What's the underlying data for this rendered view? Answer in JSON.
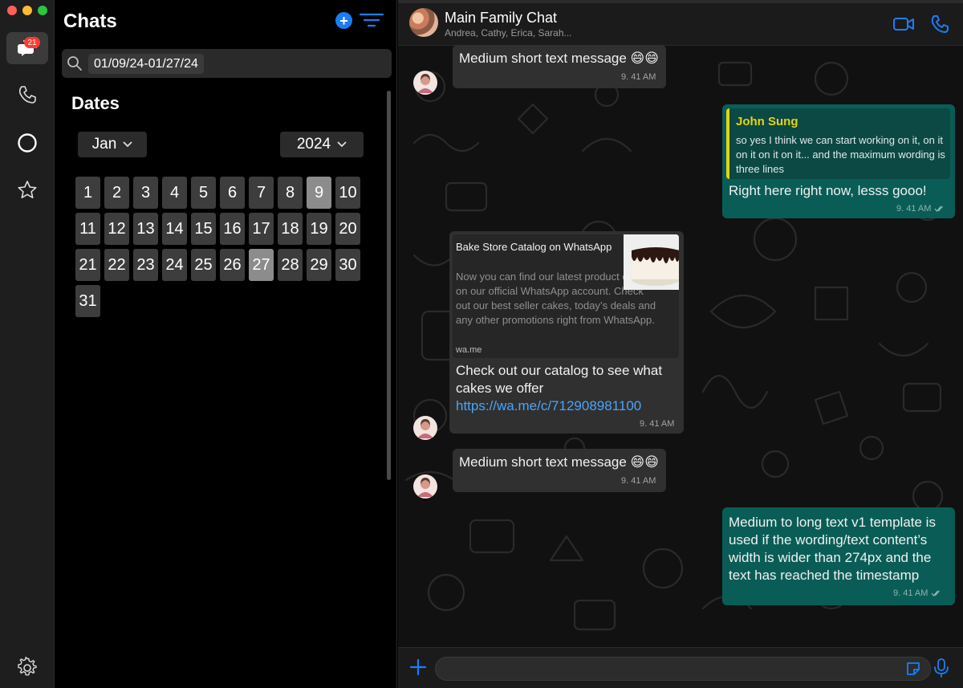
{
  "window": {
    "traffic_colors": [
      "#ff5f57",
      "#febc2e",
      "#28c840"
    ]
  },
  "rail": {
    "chats_badge": "21",
    "accent": "#1a7ef5",
    "icons": [
      "chat-bubbles-icon",
      "phone-icon",
      "status-ring-icon",
      "star-icon",
      "gear-icon"
    ]
  },
  "panel": {
    "title": "Chats",
    "search_value": "01/09/24-01/27/24",
    "dates_title": "Dates",
    "month": "Jan",
    "year": "2024",
    "days": [
      "1",
      "2",
      "3",
      "4",
      "5",
      "6",
      "7",
      "8",
      "9",
      "10",
      "11",
      "12",
      "13",
      "14",
      "15",
      "16",
      "17",
      "18",
      "19",
      "20",
      "21",
      "22",
      "23",
      "24",
      "25",
      "26",
      "27",
      "28",
      "29",
      "30",
      "31"
    ],
    "selected_days": [
      "9",
      "27"
    ]
  },
  "chat": {
    "title": "Main Family Chat",
    "participants": "Andrea, Cathy, Erica, Sarah...",
    "messages": [
      {
        "text": "Medium short text message 😄😄",
        "time": "9. 41 AM"
      },
      {
        "reply_name": "John Sung",
        "reply_text": "so yes I think we can start working on it, on it on it on it on it... and the maximum wording is three lines",
        "text": "Right here right now, lesss gooo!",
        "time": "9. 41 AM"
      },
      {
        "preview_title": "Bake Store Catalog on WhatsApp",
        "preview_desc": "Now you can find our latest product catalog on our official WhatsApp account. Check out our best seller cakes, today’s deals and any other promotions right from WhatsApp.",
        "preview_domain": "wa.me",
        "text": "Check out our catalog to see what cakes we offer",
        "link": "https://wa.me/c/712908981100",
        "time": "9. 41 AM"
      },
      {
        "text": "Medium short text message 😄😄",
        "time": "9. 41 AM"
      },
      {
        "text": "Medium to long text v1 template is used if the wording/text content’s width is wider than 274px and the text has reached the timestamp",
        "time": "9. 41 AM"
      }
    ]
  }
}
